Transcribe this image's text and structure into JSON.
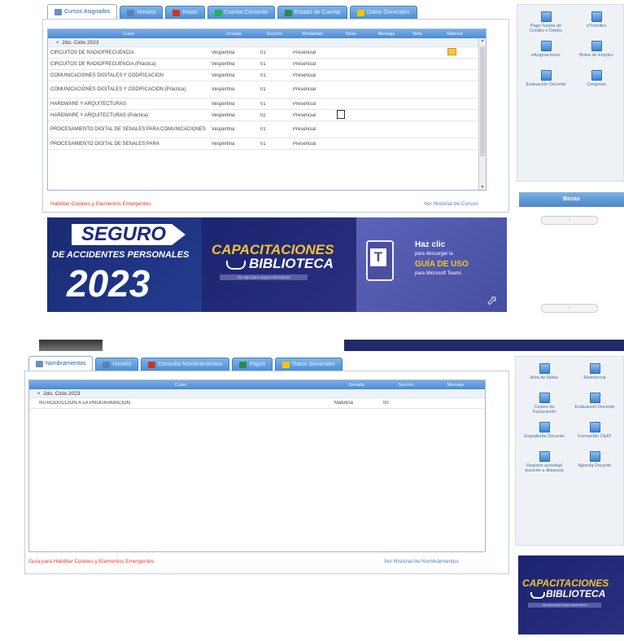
{
  "top": {
    "tabs": [
      {
        "label": "Cursos Asignados",
        "icon": "document-icon",
        "color": "#6b8fbf"
      },
      {
        "label": "Horario",
        "icon": "schedule-icon",
        "color": "#5e7fb5"
      },
      {
        "label": "Notas",
        "icon": "grades-icon",
        "color": "#c0392b"
      },
      {
        "label": "Cuenta Corriente",
        "icon": "account-icon",
        "color": "#27ae60"
      },
      {
        "label": "Estado de Cuenta",
        "icon": "status-icon",
        "color": "#2c8a4a"
      },
      {
        "label": "Datos Generales",
        "icon": "folder-icon",
        "color": "#f1c40f"
      }
    ],
    "columns": [
      "Curso",
      "Jornada",
      "Sección",
      "Modalidad",
      "Tarea",
      "Mensaje",
      "Nota",
      "Material"
    ],
    "group": "2do. Ciclo 2023",
    "rows": [
      {
        "curso": "CIRCUITOS DE RADIOFRECUENCIA",
        "jornada": "Vespertina",
        "seccion": "01",
        "modalidad": "Presencial",
        "tarea": "",
        "material": "folder"
      },
      {
        "curso": "CIRCUITOS DE RADIOFRECUENCIA (Práctica)",
        "jornada": "Vespertina",
        "seccion": "01",
        "modalidad": "Presencial",
        "tarea": "",
        "material": ""
      },
      {
        "curso": "COMUNICACIONES DIGITALES Y CODIFICACION",
        "jornada": "Vespertina",
        "seccion": "01",
        "modalidad": "Presencial",
        "tarea": "",
        "material": ""
      },
      {
        "curso": "COMUNICACIONES DIGITALES Y CODIFICACION (Práctica)",
        "jornada": "Vespertina",
        "seccion": "01",
        "modalidad": "Presencial",
        "tarea": "",
        "material": ""
      },
      {
        "curso": "HARDWARE Y ARQUITECTURAS",
        "jornada": "Vespertina",
        "seccion": "01",
        "modalidad": "Presencial",
        "tarea": "",
        "material": ""
      },
      {
        "curso": "HARDWARE Y ARQUITECTURAS (Práctica)",
        "jornada": "Vespertina",
        "seccion": "02",
        "modalidad": "Presencial",
        "tarea": "task",
        "material": ""
      },
      {
        "curso": "PROCESAMIENTO DIGITAL DE SEÑALES PARA COMUNICACIONES",
        "jornada": "Vespertina",
        "seccion": "01",
        "modalidad": "Presencial",
        "tarea": "",
        "material": ""
      },
      {
        "curso": "PROCESAMIENTO DIGITAL DE SEÑALES PARA",
        "jornada": "Vespertina",
        "seccion": "01",
        "modalidad": "Presencial",
        "tarea": "",
        "material": ""
      }
    ],
    "enable_cookies": "Habilitar Cookies y Elementos Emergentes",
    "history": "Ver Historial de Cursos",
    "sidebar": [
      {
        "label": "Pago Tarjeta de Crédito o Débito"
      },
      {
        "label": "eTrámites"
      },
      {
        "label": "eAsignaciones"
      },
      {
        "label": "Bolsa de Empleo"
      },
      {
        "label": "Evaluación Docente"
      },
      {
        "label": "Congreso"
      }
    ],
    "becas": "Becas"
  },
  "banners": {
    "seguro": {
      "title": "SEGURO",
      "subtitle": "DE ACCIDENTES PERSONALES",
      "year": "2023"
    },
    "capacitaciones": {
      "title": "CAPACITACIONES",
      "subtitle": "BIBLIOTECA",
      "caption": "clic aquí para mayor información"
    },
    "teams": {
      "line1": "Haz clic",
      "line2": "para descargar la",
      "line3": "GUÍA DE USO",
      "line4": "para Microsoft Teams"
    }
  },
  "bottom": {
    "tabs": [
      {
        "label": "Nombramientos",
        "icon": "document-icon",
        "color": "#6b8fbf"
      },
      {
        "label": "Horario",
        "icon": "schedule-icon",
        "color": "#5e7fb5"
      },
      {
        "label": "Consulta Nombramientos",
        "icon": "grades-icon",
        "color": "#c0392b"
      },
      {
        "label": "Pagos",
        "icon": "status-icon",
        "color": "#2c8a4a"
      },
      {
        "label": "Datos Generales",
        "icon": "folder-icon",
        "color": "#f1c40f"
      }
    ],
    "columns": [
      "Curso",
      "Jornada",
      "Sección",
      "Mensaje"
    ],
    "group": "2do. Ciclo 2023",
    "rows": [
      {
        "curso": "INTRODUCCIÓN A LA PROGRAMACIÓN",
        "jornada": "Matutina",
        "seccion": "00",
        "mensaje": ""
      }
    ],
    "enable_cookies": "Guía para Habilitar Cookies y Elementos Emergentes",
    "history": "Ver Historial de Nombramientos",
    "sidebar": [
      {
        "label": "Acta de Notas"
      },
      {
        "label": "Residencia"
      },
      {
        "label": "Costeo de Facturación"
      },
      {
        "label": "Evaluación Docente"
      },
      {
        "label": "Expediente Docente"
      },
      {
        "label": "Formación CEAT"
      },
      {
        "label": "Registro actividad docente a distancia"
      },
      {
        "label": "Agenda Docente"
      }
    ],
    "promo": {
      "title": "CAPACITACIONES",
      "subtitle": "BIBLIOTECA",
      "caption": "clic aquí para mayor información"
    }
  },
  "colors": {
    "tab": "#4d8fd6",
    "header": "#4c8bd3",
    "link_red": "#e33333",
    "link_blue": "#4a7fc0",
    "banner_navy": "#1f2a6a",
    "banner_teams": "#4f5aa8"
  }
}
